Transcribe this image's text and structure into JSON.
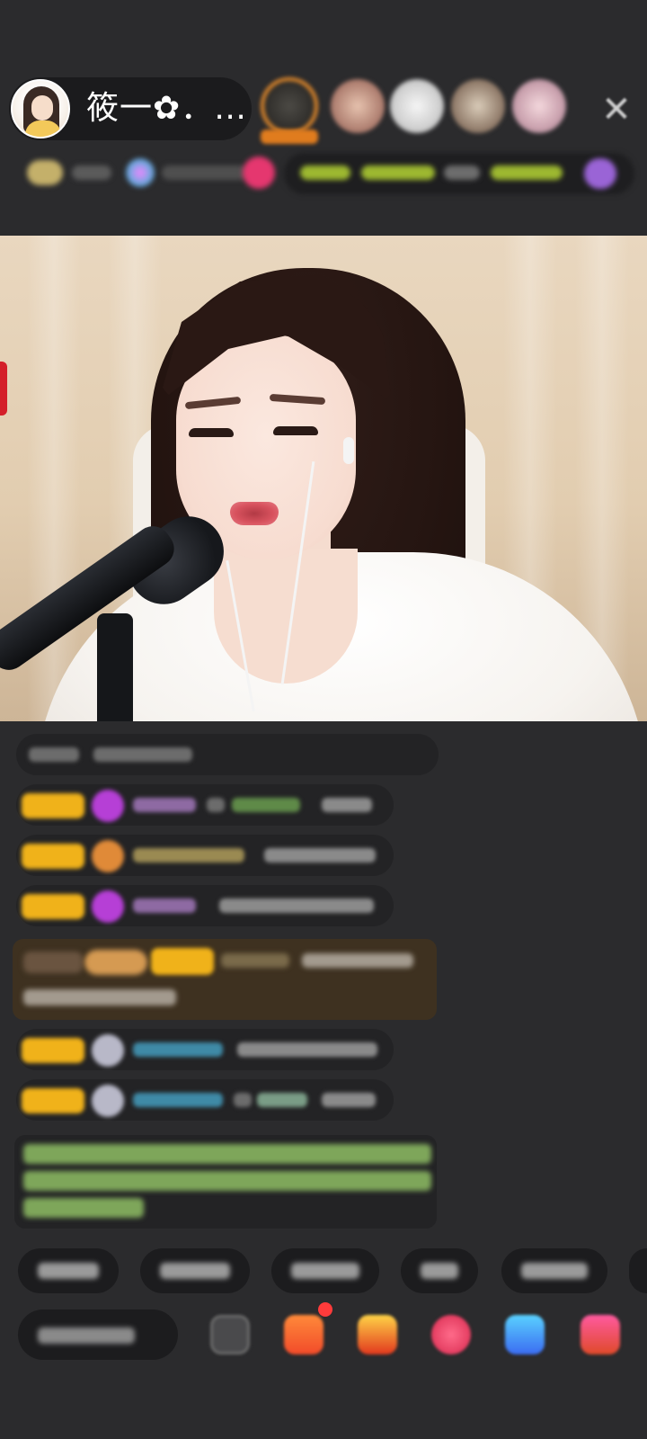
{
  "header": {
    "host_name": "筱一✿．…",
    "close_glyph": "✕"
  },
  "icons": {
    "host_avatar": "host-avatar",
    "close": "close-icon",
    "gift": "gift-icon",
    "emoji": "emoji-icon"
  },
  "colors": {
    "background": "#2b2b2d",
    "pill": "#1b1b1d",
    "top_viewer_ring": "#e48a2b",
    "badge_gold": "#f0b21a",
    "system_text": "#7ea65a",
    "notification": "#ff3b3b"
  }
}
